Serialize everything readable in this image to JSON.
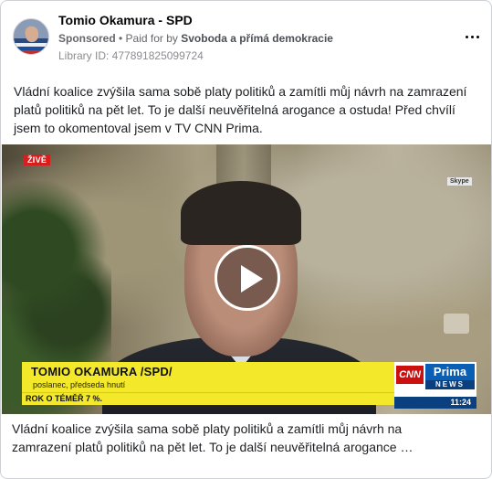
{
  "ad": {
    "page_name": "Tomio Okamura - SPD",
    "sponsored_label": "Sponsored",
    "paid_for_prefix": " • Paid for by ",
    "payer": "Svoboda a přímá demokracie",
    "library_id": "Library ID: 477891825099724",
    "more_icon": "more-dots-icon",
    "avatar_icon": "profile-photo"
  },
  "post": {
    "body_text": "Vládní koalice zvýšila sama sobě platy politiků a zamítli můj návrh na zamrazení platů politiků na pět let. To je další neuvěřitelná arogance a ostuda! Před chvílí jsem to okomentoval jsem v TV CNN Prima."
  },
  "video": {
    "live_badge": "ŽIVĚ",
    "source_tag": "Skype",
    "lower_third_name": "TOMIO OKAMURA /SPD/",
    "lower_third_role": "poslanec, předseda hnutí",
    "ticker_text": "ROK O TÉMĚŘ 7 %.",
    "channel_cnn": "CNN",
    "channel_prima": "Prima",
    "channel_news": "NEWS",
    "clock": "11:24",
    "play_icon": "play-icon"
  },
  "caption": {
    "line1": "Vládní koalice zvýšila sama sobě platy politiků a zamítli můj návrh na",
    "line2": "zamrazení platů politiků na pět let. To je další neuvěřitelná arogance …"
  }
}
